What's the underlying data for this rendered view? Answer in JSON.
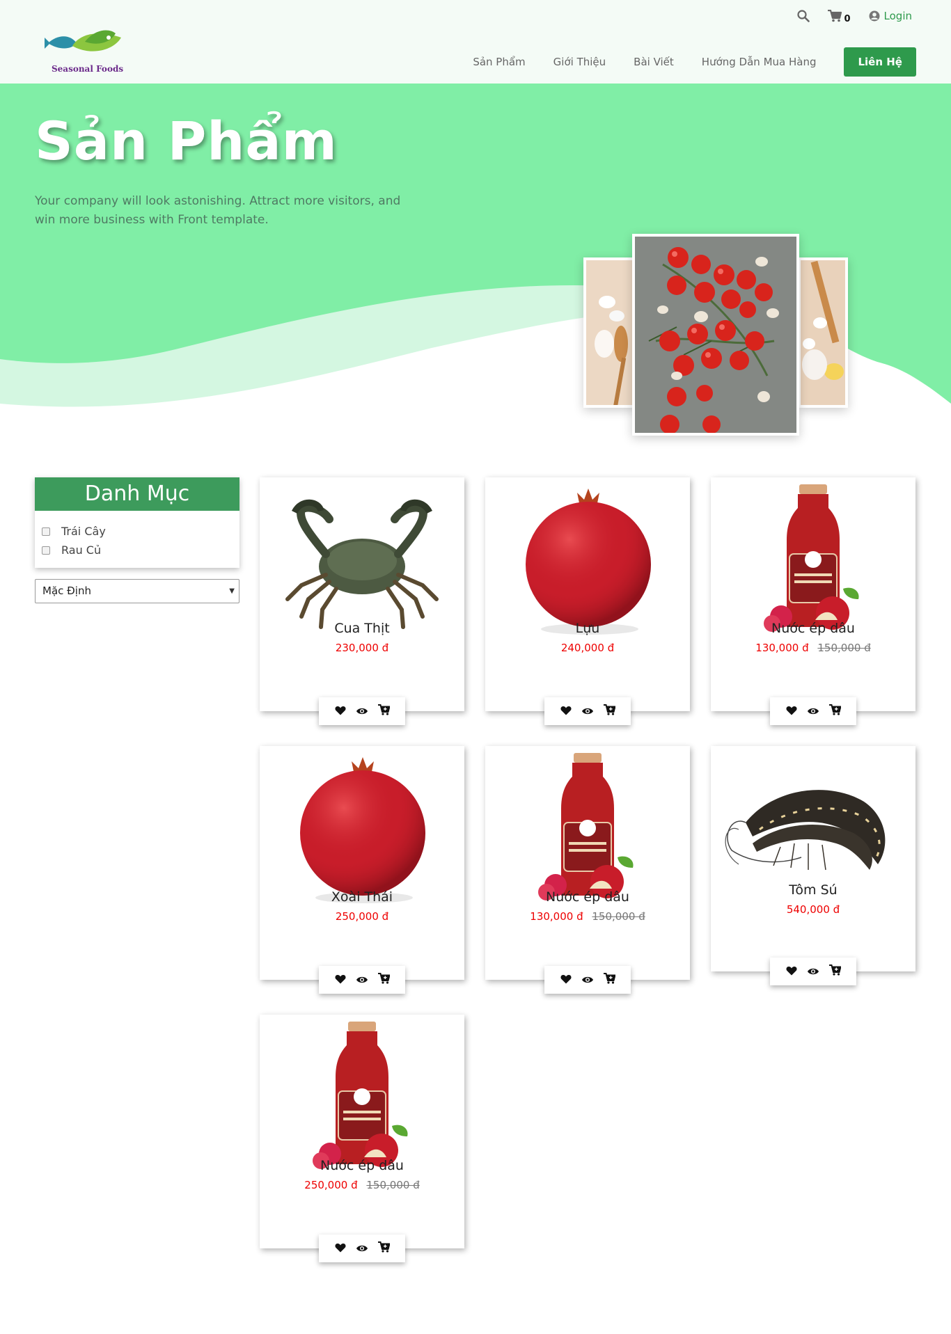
{
  "brand": {
    "logo_text": "Seasonal Foods"
  },
  "header": {
    "cart_count": "0",
    "login_label": "Login",
    "nav": [
      {
        "label": "Sản Phẩm"
      },
      {
        "label": "Giới Thiệu"
      },
      {
        "label": "Bài Viết"
      },
      {
        "label": "Hướng Dẫn Mua Hàng"
      }
    ],
    "contact_label": "Liên Hệ"
  },
  "hero": {
    "title": "Sản Phẩm",
    "subtitle": "Your company will look astonishing. Attract more visitors, and win more business with Front template."
  },
  "sidebar": {
    "title": "Danh Mục",
    "categories": [
      {
        "label": "Trái Cây"
      },
      {
        "label": "Rau Củ"
      }
    ],
    "sort_selected": "Mặc Định"
  },
  "products": [
    {
      "name": "Cua Thịt",
      "price": "230,000 đ",
      "old_price": ""
    },
    {
      "name": "Lựu",
      "price": "240,000 đ",
      "old_price": ""
    },
    {
      "name": "Nước ép dâu",
      "price": "130,000 đ",
      "old_price": "150,000 đ"
    },
    {
      "name": "Xoài Thái",
      "price": "250,000 đ",
      "old_price": ""
    },
    {
      "name": "Nước ép dâu",
      "price": "130,000 đ",
      "old_price": "150,000 đ"
    },
    {
      "name": "Tôm Sú",
      "price": "540,000 đ",
      "old_price": ""
    },
    {
      "name": "Nước ép dâu",
      "price": "250,000 đ",
      "old_price": "150,000 đ"
    }
  ],
  "colors": {
    "brand_green": "#2e9a4c",
    "hero_green": "#80eea6",
    "price_red": "#e00000"
  },
  "icons": [
    "search-icon",
    "cart-icon",
    "user-circle-icon",
    "heart-icon",
    "eye-icon",
    "add-to-cart-icon",
    "chevron-down-icon"
  ]
}
